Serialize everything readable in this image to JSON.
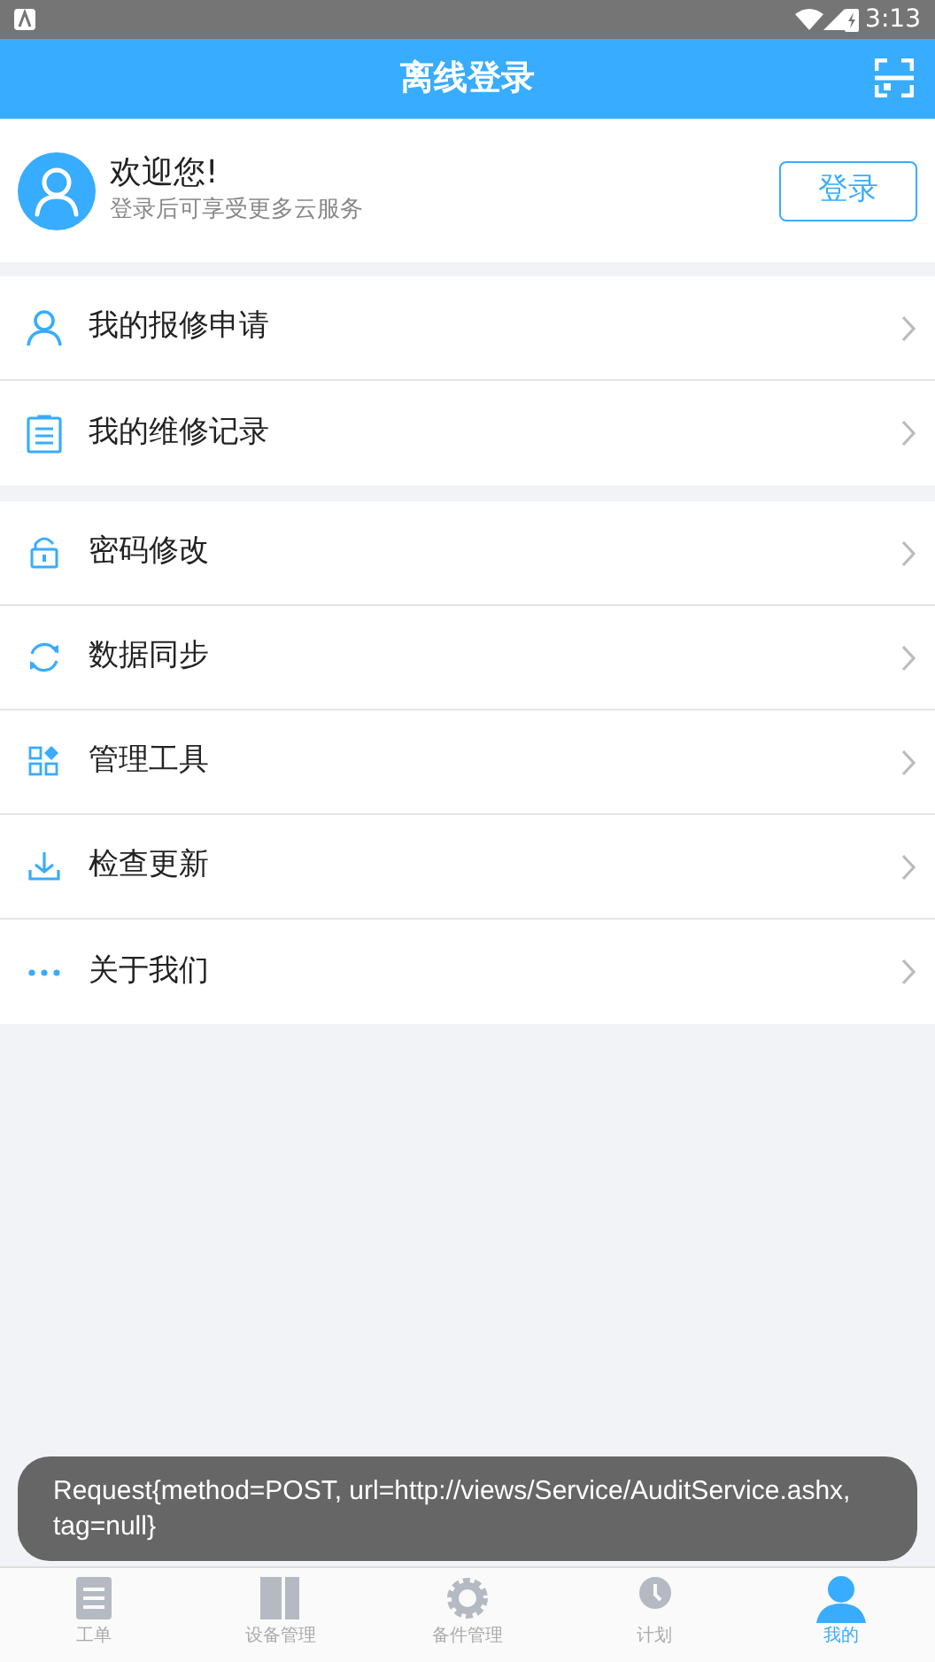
{
  "status_bar": {
    "time": "3:13"
  },
  "header": {
    "title": "离线登录"
  },
  "profile": {
    "greeting": "欢迎您!",
    "subtitle": "登录后可享受更多云服务",
    "login_button": "登录"
  },
  "menu_groups": [
    {
      "items": [
        {
          "label": "我的报修申请"
        },
        {
          "label": "我的维修记录"
        }
      ]
    },
    {
      "items": [
        {
          "label": "密码修改"
        },
        {
          "label": "数据同步"
        },
        {
          "label": "管理工具"
        },
        {
          "label": "检查更新"
        },
        {
          "label": "关于我们"
        }
      ]
    }
  ],
  "toast": {
    "text": "Request{method=POST, url=http://views/Service/AuditService.ashx, tag=null}"
  },
  "tab_bar": [
    {
      "label": "工单",
      "selected": false
    },
    {
      "label": "设备管理",
      "selected": false
    },
    {
      "label": "备件管理",
      "selected": false
    },
    {
      "label": "计划",
      "selected": false
    },
    {
      "label": "我的",
      "selected": true
    }
  ]
}
